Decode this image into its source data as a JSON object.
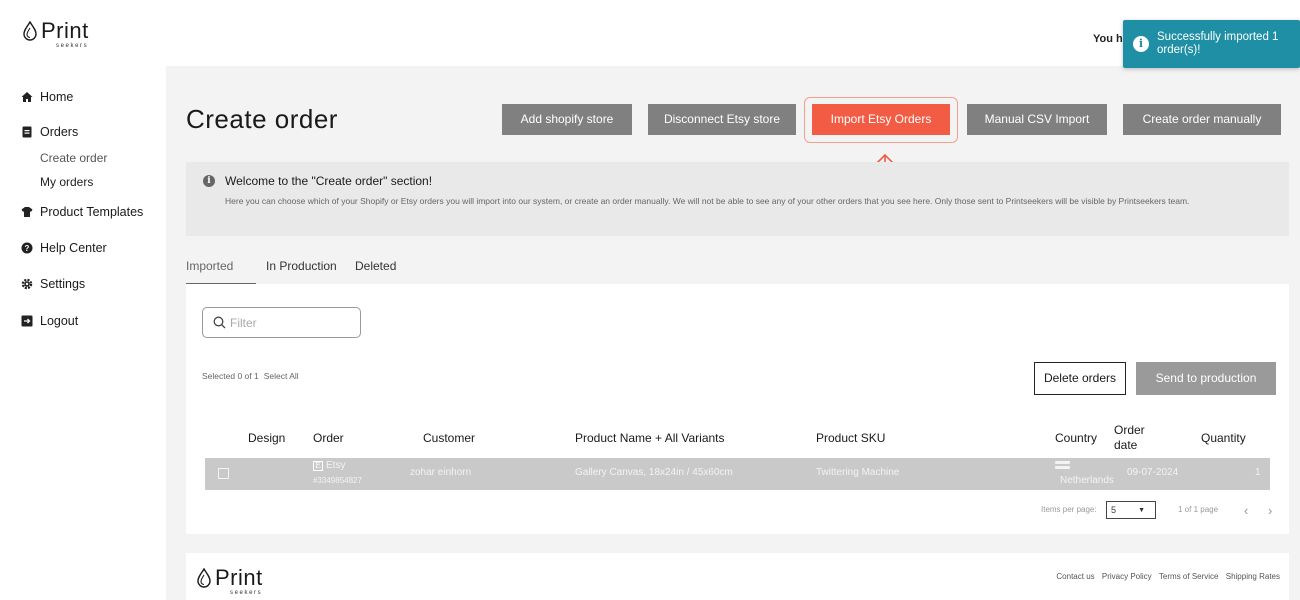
{
  "brand": {
    "name": "Print",
    "tagline": "seekers"
  },
  "header": {
    "you_have": "You ha"
  },
  "toast": {
    "message": "Successfully imported 1 order(s)!",
    "color": "#1f8fa6"
  },
  "sidebar": {
    "items": [
      {
        "label": "Home",
        "icon": "home-icon"
      },
      {
        "label": "Orders",
        "icon": "orders-icon"
      },
      {
        "label": "Product Templates",
        "icon": "tshirt-icon"
      },
      {
        "label": "Help Center",
        "icon": "help-icon"
      },
      {
        "label": "Settings",
        "icon": "gear-icon"
      },
      {
        "label": "Logout",
        "icon": "logout-icon"
      }
    ],
    "subitems": [
      {
        "label": "Create order",
        "active": true
      },
      {
        "label": "My orders",
        "active": false
      }
    ]
  },
  "page": {
    "title": "Create order"
  },
  "actions": {
    "add_shopify": "Add shopify store",
    "disconnect_etsy": "Disconnect Etsy store",
    "import_etsy": "Import Etsy Orders",
    "manual_csv": "Manual CSV Import",
    "create_manually": "Create order manually",
    "accent": "#f25c45"
  },
  "welcome": {
    "title": "Welcome to the \"Create order\" section!",
    "body": "Here you can choose which of your Shopify or Etsy orders you will import into our system, or create an order manually. We will not be able to see any of your other orders that you see here. Only those sent to Printseekers will be visible by Printseekers team."
  },
  "tabs": [
    {
      "label": "Imported",
      "selected": true
    },
    {
      "label": "In Production",
      "selected": false
    },
    {
      "label": "Deleted",
      "selected": false
    }
  ],
  "filter": {
    "placeholder": "Filter",
    "value": ""
  },
  "selection": {
    "text": "Selected 0 of 1",
    "select_all": "Select All"
  },
  "bulk": {
    "delete": "Delete orders",
    "send": "Send to production"
  },
  "table": {
    "headers": {
      "design": "Design",
      "order": "Order",
      "customer": "Customer",
      "product": "Product Name + All Variants",
      "sku": "Product SKU",
      "country": "Country",
      "order_date": "Order date",
      "quantity": "Quantity"
    },
    "rows": [
      {
        "source": "Etsy",
        "order_number": "#3349854827",
        "customer": "zohar einhorn",
        "product": "Gallery Canvas, 18x24in / 45x60cm",
        "sku": "Twittering Machine",
        "country": "Netherlands",
        "order_date": "09-07-2024",
        "quantity": "1"
      }
    ]
  },
  "pagination": {
    "items_per_page_label": "Items per page:",
    "items_per_page": "5",
    "page_info": "1 of 1 page"
  },
  "footer": {
    "links": [
      "Contact us",
      "Privacy Policy",
      "Terms of Service",
      "Shipping Rates"
    ]
  }
}
